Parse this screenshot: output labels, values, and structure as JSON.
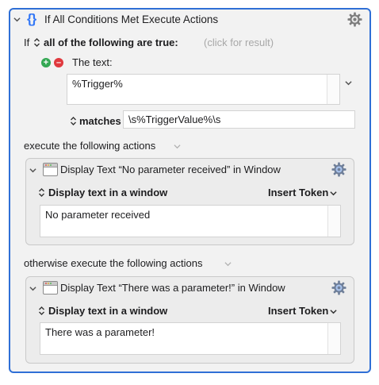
{
  "action": {
    "title": "If All Conditions Met Execute Actions"
  },
  "condition": {
    "if_label": "If",
    "quantifier": "all of the following are true:",
    "result_hint": "(click for result)",
    "type_label": "The text:",
    "text_value": "%Trigger%",
    "operator": "matches",
    "pattern": "\\s%TriggerValue%\\s"
  },
  "then_block": {
    "header": "execute the following actions",
    "action_title": "Display Text “No parameter received” in Window",
    "mode_label": "Display text in a window",
    "insert_token": "Insert Token",
    "text": "No parameter received"
  },
  "else_block": {
    "header": "otherwise execute the following actions",
    "action_title": "Display Text “There was a parameter!” in Window",
    "mode_label": "Display text in a window",
    "insert_token": "Insert Token",
    "text": "There was a parameter!"
  },
  "colors": {
    "accent": "#2f6fd6",
    "add": "#34a853",
    "remove": "#e0393e"
  },
  "icons": {
    "action": "curly-braces-icon",
    "gear": "gear-icon",
    "window": "window-icon"
  }
}
